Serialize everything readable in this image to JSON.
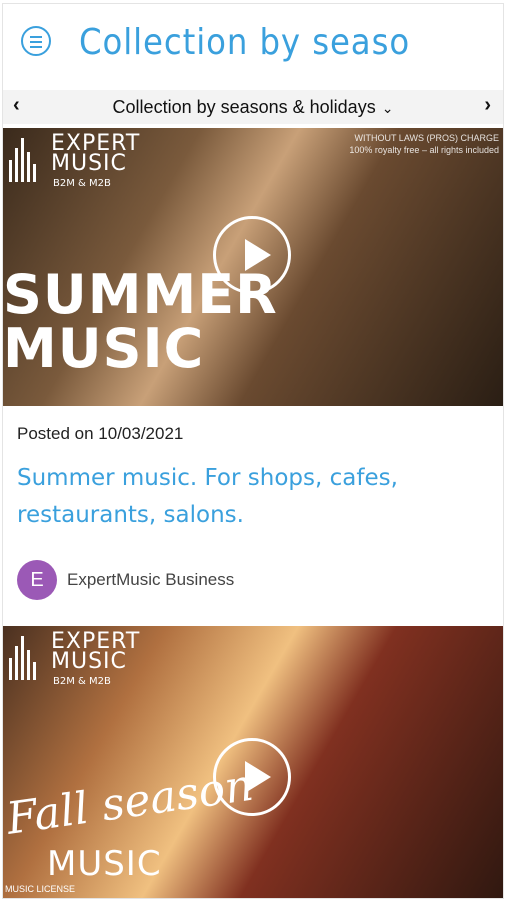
{
  "header": {
    "title": "Collection by seaso",
    "menu_icon": "menu-icon"
  },
  "subnav": {
    "label": "Collection by seasons & holidays",
    "prev_icon": "chevron-left-icon",
    "next_icon": "chevron-right-icon",
    "dropdown_icon": "chevron-down-icon"
  },
  "post1": {
    "brand_name": "EXPERT MUSIC",
    "brand_tag": "B2M & M2B",
    "corner_line1": "WITHOUT LAWS (PROS) CHARGE",
    "corner_line2": "100% royalty free – all rights included",
    "overlay_text_1": "SUMMER",
    "overlay_text_2": "MUSIC",
    "date": "Posted on 10/03/2021",
    "title": "Summer music. For shops, cafes, restaurants, salons.",
    "author_initial": "E",
    "author_name": "ExpertMusic Business"
  },
  "post2": {
    "brand_name": "EXPERT MUSIC",
    "brand_tag": "B2M & M2B",
    "overlay_script": "Fall season",
    "overlay_text": "MUSIC",
    "license": "MUSIC LICENSE"
  },
  "colors": {
    "accent": "#3aa0dd",
    "avatar": "#9b59b6"
  }
}
